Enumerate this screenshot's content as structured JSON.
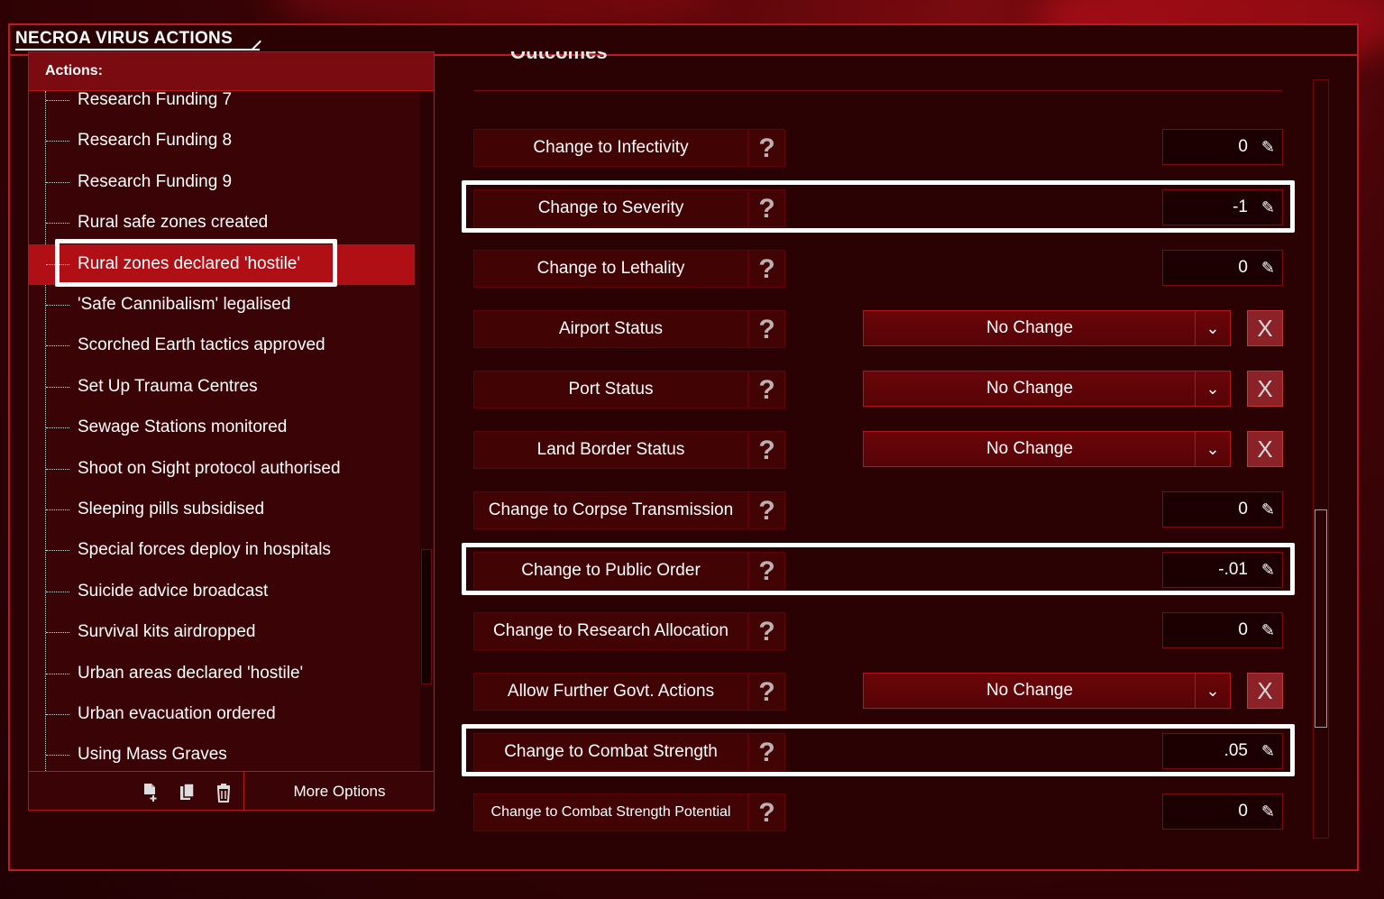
{
  "window": {
    "title": "NECROA VIRUS ACTIONS"
  },
  "actions": {
    "header": "Actions:",
    "items": [
      {
        "label": "Research Funding 7"
      },
      {
        "label": "Research Funding 8"
      },
      {
        "label": "Research Funding 9"
      },
      {
        "label": "Rural safe zones created"
      },
      {
        "label": "Rural zones declared 'hostile'",
        "selected": true
      },
      {
        "label": "'Safe Cannibalism' legalised"
      },
      {
        "label": "Scorched Earth tactics approved"
      },
      {
        "label": "Set Up Trauma Centres"
      },
      {
        "label": "Sewage Stations monitored"
      },
      {
        "label": "Shoot on Sight protocol authorised"
      },
      {
        "label": "Sleeping pills subsidised"
      },
      {
        "label": "Special forces deploy in hospitals"
      },
      {
        "label": "Suicide advice broadcast"
      },
      {
        "label": "Survival kits airdropped"
      },
      {
        "label": "Urban areas declared 'hostile'"
      },
      {
        "label": "Urban evacuation ordered"
      },
      {
        "label": "Using Mass Graves"
      }
    ],
    "footer": {
      "more_options": "More Options",
      "icons": [
        "add-file-icon",
        "copy-icon",
        "trash-icon"
      ]
    }
  },
  "outcomes": {
    "section_title": "Outcomes",
    "help_glyph": "?",
    "edit_glyph": "✎",
    "close_glyph": "X",
    "chevron_glyph": "⌄",
    "rows": [
      {
        "label": "Change to Infectivity",
        "type": "number",
        "value": "0"
      },
      {
        "label": "Change to Severity",
        "type": "number",
        "value": "-1",
        "highlight": true
      },
      {
        "label": "Change to Lethality",
        "type": "number",
        "value": "0"
      },
      {
        "label": "Airport Status",
        "type": "select",
        "value": "No Change"
      },
      {
        "label": "Port Status",
        "type": "select",
        "value": "No Change"
      },
      {
        "label": "Land Border Status",
        "type": "select",
        "value": "No Change"
      },
      {
        "label": "Change to Corpse Transmission",
        "type": "number",
        "value": "0"
      },
      {
        "label": "Change to Public Order",
        "type": "number",
        "value": "-.01",
        "highlight": true
      },
      {
        "label": "Change to Research Allocation",
        "type": "number",
        "value": "0"
      },
      {
        "label": "Allow Further Govt. Actions",
        "type": "select",
        "value": "No Change"
      },
      {
        "label": "Change to Combat Strength",
        "type": "number",
        "value": ".05",
        "highlight": true
      },
      {
        "label": "Change to Combat Strength Potential",
        "type": "number",
        "value": "0"
      }
    ]
  },
  "colors": {
    "accent": "#c01a1f",
    "selected": "#b00f16",
    "panel": "#2a0204",
    "field": "#1c0001"
  }
}
